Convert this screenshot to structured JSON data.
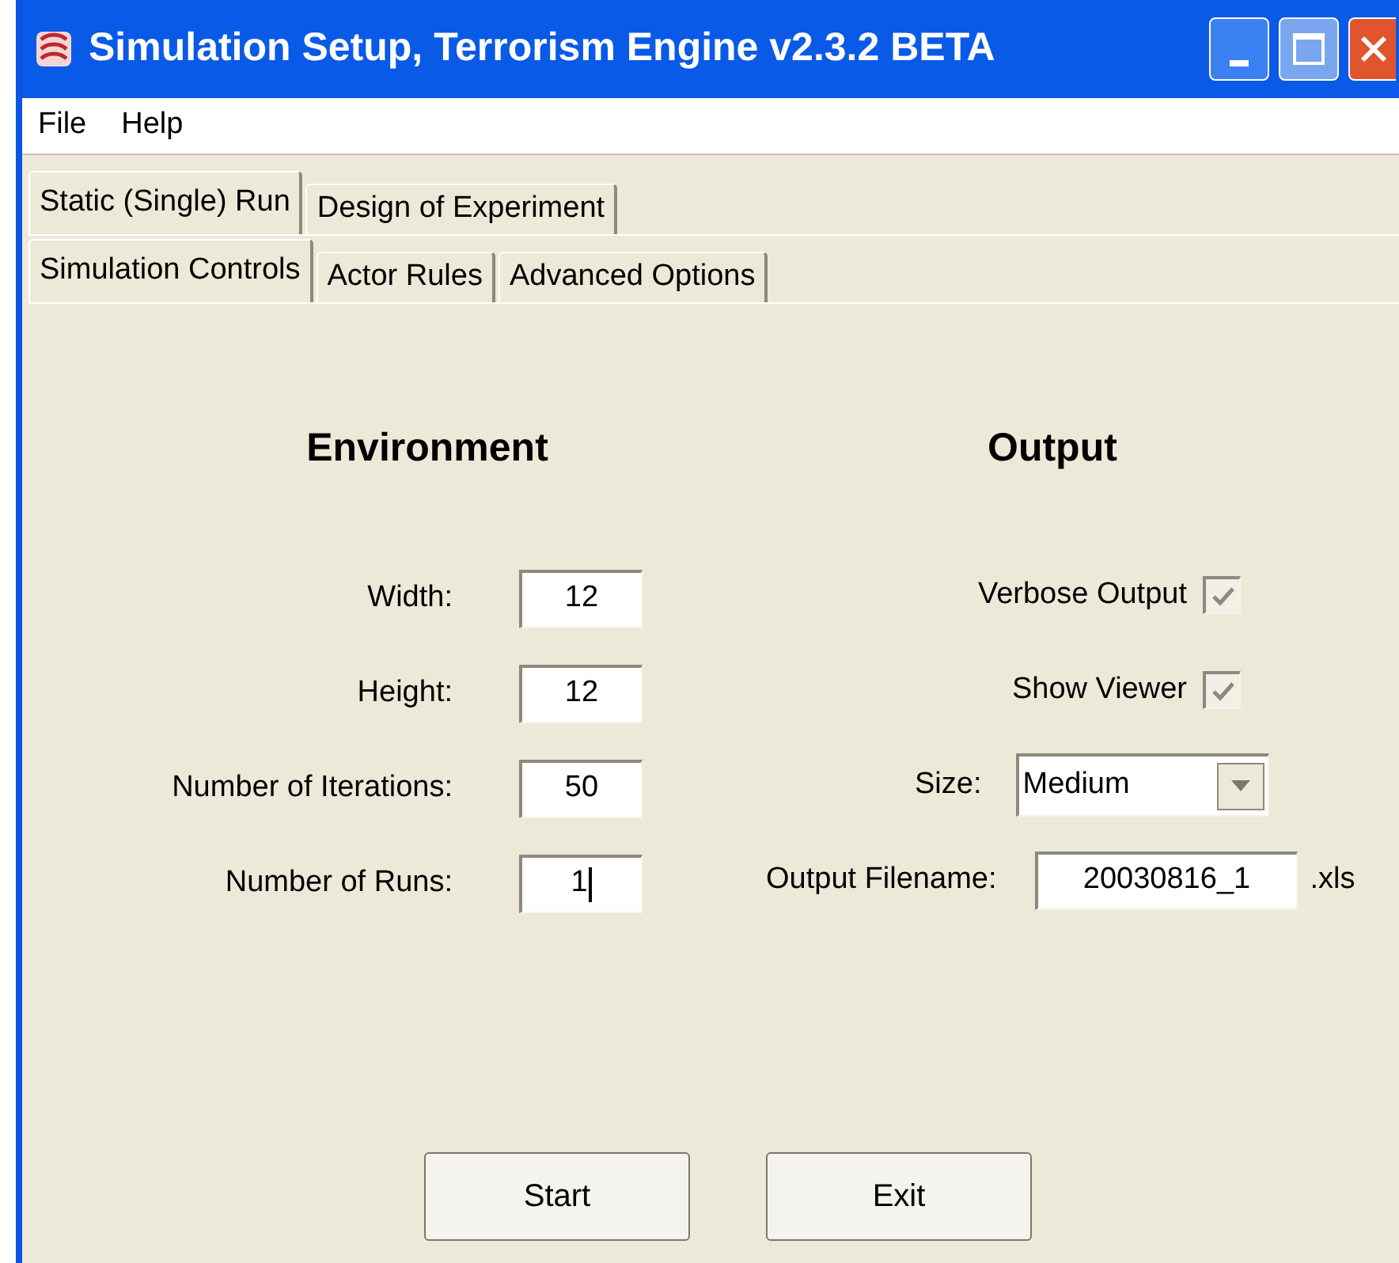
{
  "window": {
    "title": "Simulation Setup, Terrorism Engine v2.3.2 BETA"
  },
  "menu": [
    "File",
    "Help"
  ],
  "outer_tabs": [
    {
      "label": "Static (Single) Run",
      "selected": true
    },
    {
      "label": "Design of Experiment",
      "selected": false
    }
  ],
  "inner_tabs": [
    {
      "label": "Simulation Controls",
      "selected": true
    },
    {
      "label": "Actor Rules",
      "selected": false
    },
    {
      "label": "Advanced Options",
      "selected": false
    }
  ],
  "environment": {
    "heading": "Environment",
    "fields": [
      {
        "label": "Width:",
        "value": "12",
        "focused": false
      },
      {
        "label": "Height:",
        "value": "12",
        "focused": false
      },
      {
        "label": "Number of Iterations:",
        "value": "50",
        "focused": false
      },
      {
        "label": "Number of Runs:",
        "value": "1",
        "focused": true
      }
    ]
  },
  "output": {
    "heading": "Output",
    "rows": [
      {
        "kind": "checkbox",
        "label": "Verbose Output",
        "checked": true
      },
      {
        "kind": "checkbox",
        "label": "Show Viewer",
        "checked": true
      },
      {
        "kind": "select",
        "label": "Size:",
        "value": "Medium"
      },
      {
        "kind": "file",
        "label": "Output Filename:",
        "value": "20030816_1",
        "suffix": ".xls"
      }
    ]
  },
  "buttons": [
    "Start",
    "Exit"
  ]
}
